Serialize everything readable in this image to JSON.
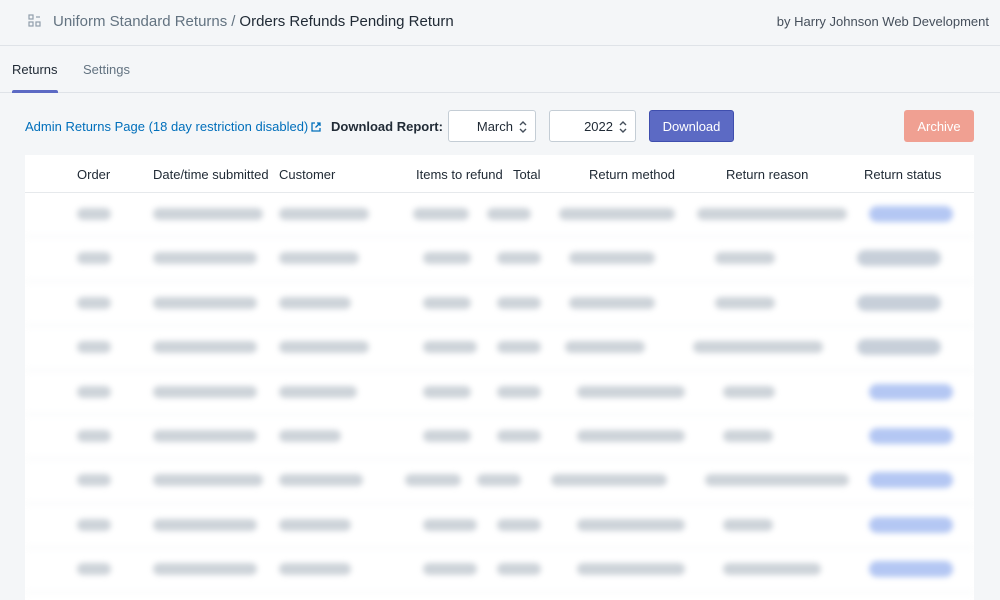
{
  "header": {
    "app_name": "Uniform Standard Returns",
    "separator": "/",
    "page_title": "Orders Refunds Pending Return",
    "byline": "by Harry Johnson Web Development"
  },
  "tabs": [
    {
      "label": "Returns",
      "active": true
    },
    {
      "label": "Settings",
      "active": false
    }
  ],
  "toolbar": {
    "admin_link": "Admin Returns Page (18 day restriction disabled)",
    "download_label": "Download Report:",
    "month": "March",
    "year": "2022",
    "download_button": "Download",
    "archive_button": "Archive"
  },
  "table": {
    "columns": [
      "Order",
      "Date/time submitted",
      "Customer",
      "Items to refund",
      "Total",
      "Return method",
      "Return reason",
      "Return status"
    ],
    "row_count": 9,
    "status_colors": [
      "blue",
      "gray",
      "gray",
      "gray",
      "blue",
      "blue",
      "blue",
      "blue",
      "blue"
    ]
  },
  "colors": {
    "accent": "#5c6ac4",
    "link": "#006fbb",
    "archive": "#f0a092",
    "status_blue": "#b4c7f3",
    "status_gray": "#c7cfd9"
  },
  "icons": {
    "app": "grid-icon",
    "external": "external-link-icon",
    "select": "chevron-updown-icon"
  }
}
